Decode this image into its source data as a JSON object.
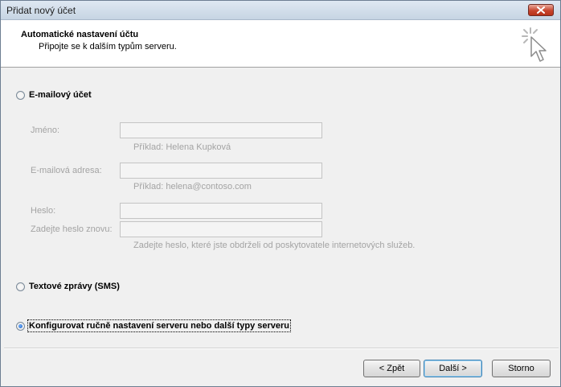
{
  "window": {
    "title": "Přidat nový účet"
  },
  "header": {
    "title": "Automatické nastavení účtu",
    "subtitle": "Připojte se k dalším typům serveru.",
    "icon": "wizard-cursor-icon"
  },
  "email_account": {
    "label": "E-mailový účet",
    "selected": false,
    "name_label": "Jméno:",
    "name_value": "",
    "name_hint": "Příklad: Helena Kupková",
    "email_label": "E-mailová adresa:",
    "email_value": "",
    "email_hint": "Příklad: helena@contoso.com",
    "password_label": "Heslo:",
    "password_value": "",
    "password_confirm_label": "Zadejte heslo znovu:",
    "password_confirm_value": "",
    "password_hint": "Zadejte heslo, které jste obdrželi od poskytovatele internetových služeb."
  },
  "sms_option": {
    "label": "Textové zprávy (SMS)",
    "selected": false
  },
  "manual_option": {
    "label": "Konfigurovat ručně nastavení serveru nebo další typy serveru",
    "selected": true
  },
  "buttons": {
    "back": "< Zpět",
    "next": "Další >",
    "cancel": "Storno"
  }
}
